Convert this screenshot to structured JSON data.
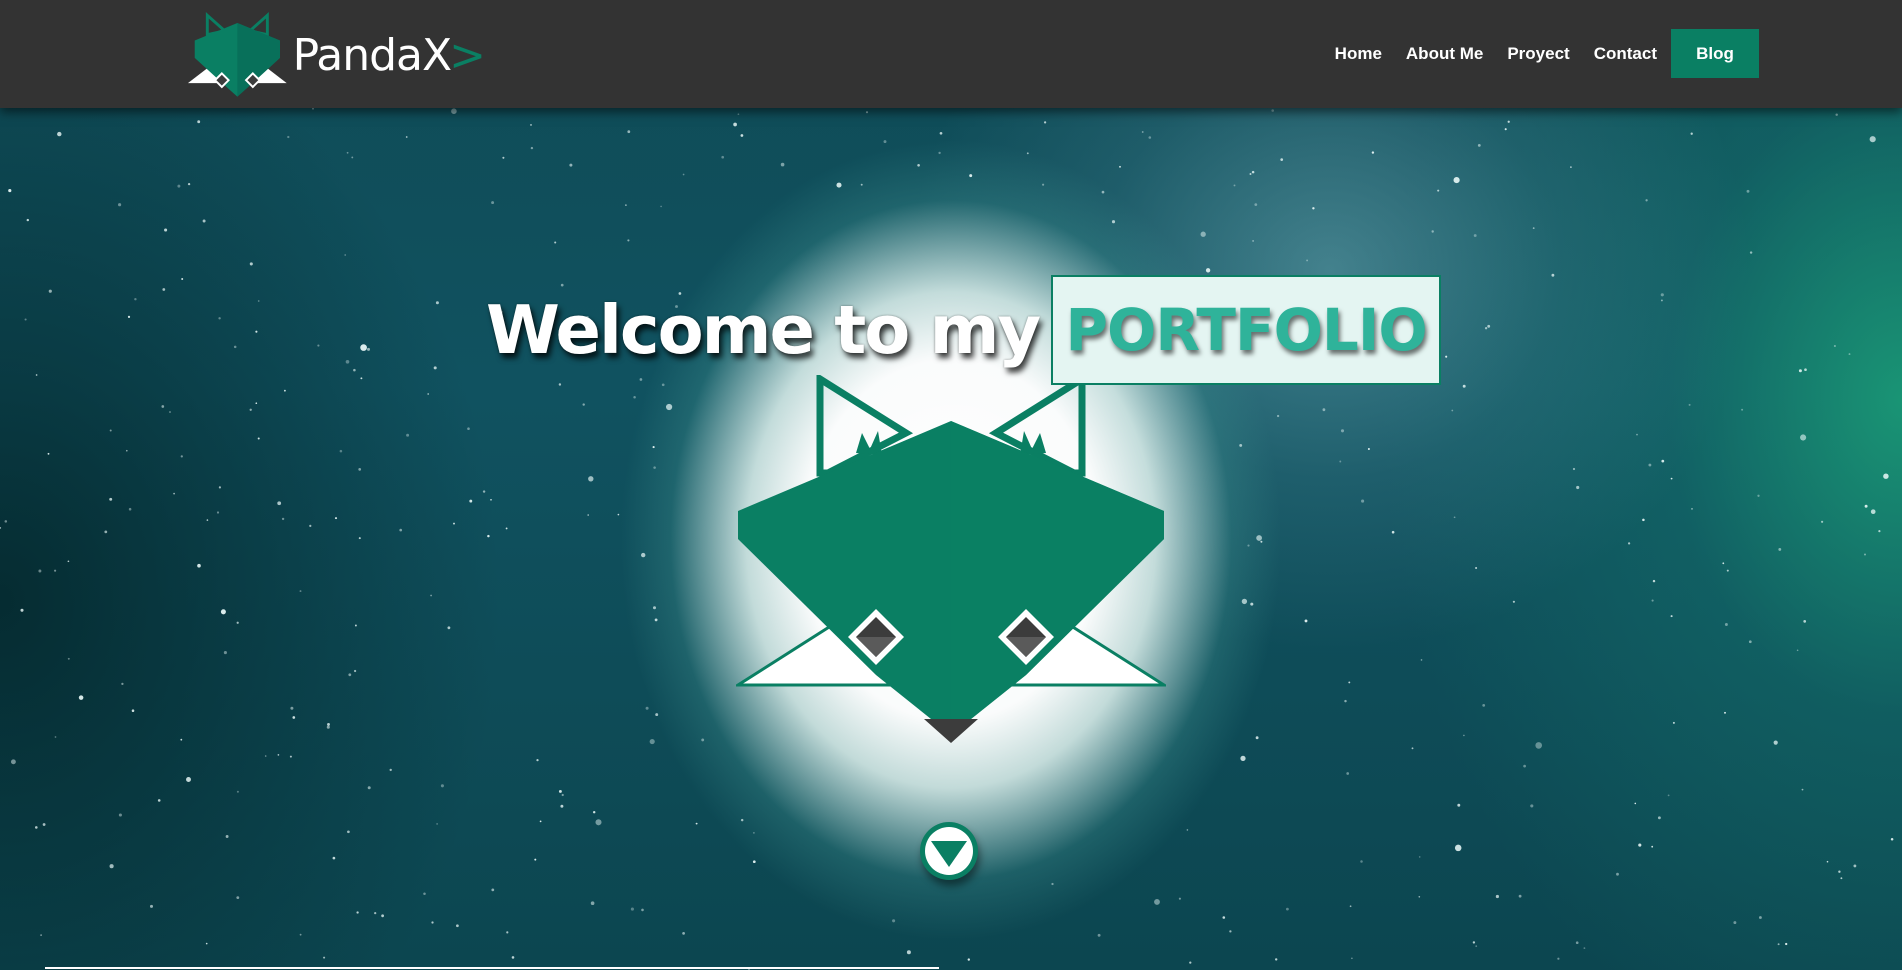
{
  "brand": {
    "name": "PandaX",
    "arrow": ">",
    "logo_icon": "fox-head-icon"
  },
  "nav": {
    "items": [
      {
        "label": "Home"
      },
      {
        "label": "About Me"
      },
      {
        "label": "Proyect"
      },
      {
        "label": "Contact"
      }
    ],
    "cta": {
      "label": "Blog"
    }
  },
  "hero": {
    "headline_prefix": "Welcome to my",
    "headline_highlight": "PORTFOLIO",
    "mascot_icon": "fox-head-icon",
    "scroll_icon": "chevron-down-icon"
  },
  "colors": {
    "accent": "#0a7f63",
    "accent_light": "#2fb39a",
    "navbar": "#333333",
    "highlight_bg": "#e4f5f2",
    "text": "#ffffff",
    "dark_gray": "#3c3c3c"
  },
  "scroll_indicator": {
    "progress": 0.47
  }
}
